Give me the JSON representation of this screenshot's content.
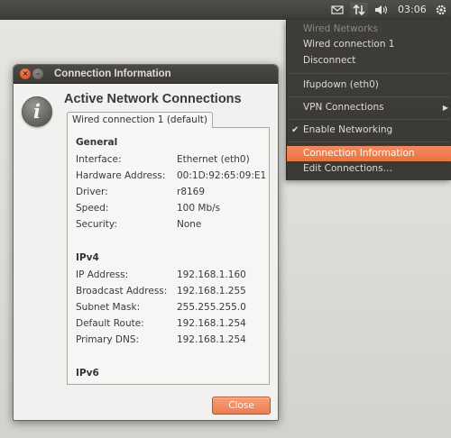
{
  "panel": {
    "clock": "03:06",
    "icons": [
      "mail-icon",
      "network-icon",
      "volume-icon",
      "gear-icon"
    ]
  },
  "dialog": {
    "title": "Connection Information",
    "heading": "Active Network Connections",
    "tab_label": "Wired connection 1 (default)",
    "general": {
      "heading": "General",
      "rows": [
        {
          "key": "Interface:",
          "value": "Ethernet (eth0)"
        },
        {
          "key": "Hardware Address:",
          "value": "00:1D:92:65:09:E1"
        },
        {
          "key": "Driver:",
          "value": "r8169"
        },
        {
          "key": "Speed:",
          "value": "100 Mb/s"
        },
        {
          "key": "Security:",
          "value": "None"
        }
      ]
    },
    "ipv4": {
      "heading": "IPv4",
      "rows": [
        {
          "key": "IP Address:",
          "value": "192.168.1.160"
        },
        {
          "key": "Broadcast Address:",
          "value": "192.168.1.255"
        },
        {
          "key": "Subnet Mask:",
          "value": "255.255.255.0"
        },
        {
          "key": "Default Route:",
          "value": "192.168.1.254"
        },
        {
          "key": "Primary DNS:",
          "value": "192.168.1.254"
        }
      ]
    },
    "ipv6": {
      "heading": "IPv6"
    },
    "close_label": "Close"
  },
  "menu": {
    "items": [
      {
        "label": "Wired Networks"
      },
      {
        "label": "Wired connection 1"
      },
      {
        "label": "Disconnect"
      },
      {
        "label": "Ifupdown (eth0)"
      },
      {
        "label": "VPN Connections"
      },
      {
        "label": "Enable Networking"
      },
      {
        "label": "Connection Information"
      },
      {
        "label": "Edit Connections…"
      }
    ]
  },
  "colors": {
    "accent": "#ec7c4f",
    "panel": "#3c3b37",
    "menu_text": "#dfdbd2"
  }
}
